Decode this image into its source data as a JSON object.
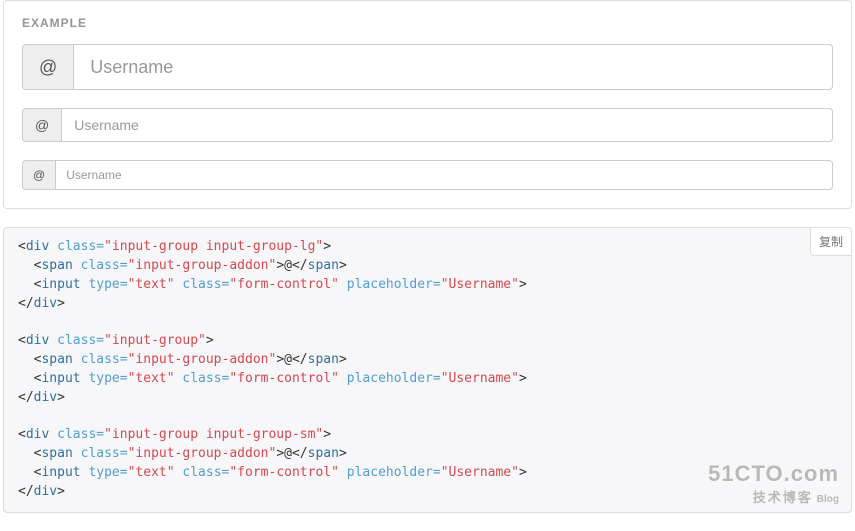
{
  "example_label": "EXAMPLE",
  "addon_text": "@",
  "placeholder": "Username",
  "copy_label": "复制",
  "code": {
    "groups": [
      {
        "div_class": "input-group input-group-lg"
      },
      {
        "div_class": "input-group"
      },
      {
        "div_class": "input-group input-group-sm"
      }
    ],
    "span_class": "input-group-addon",
    "input_type": "text",
    "input_class": "form-control",
    "input_placeholder": "Username",
    "addon_content": "@"
  },
  "watermark": {
    "line1": "51CTO.com",
    "line2": "技术博客",
    "blog": "Blog"
  }
}
